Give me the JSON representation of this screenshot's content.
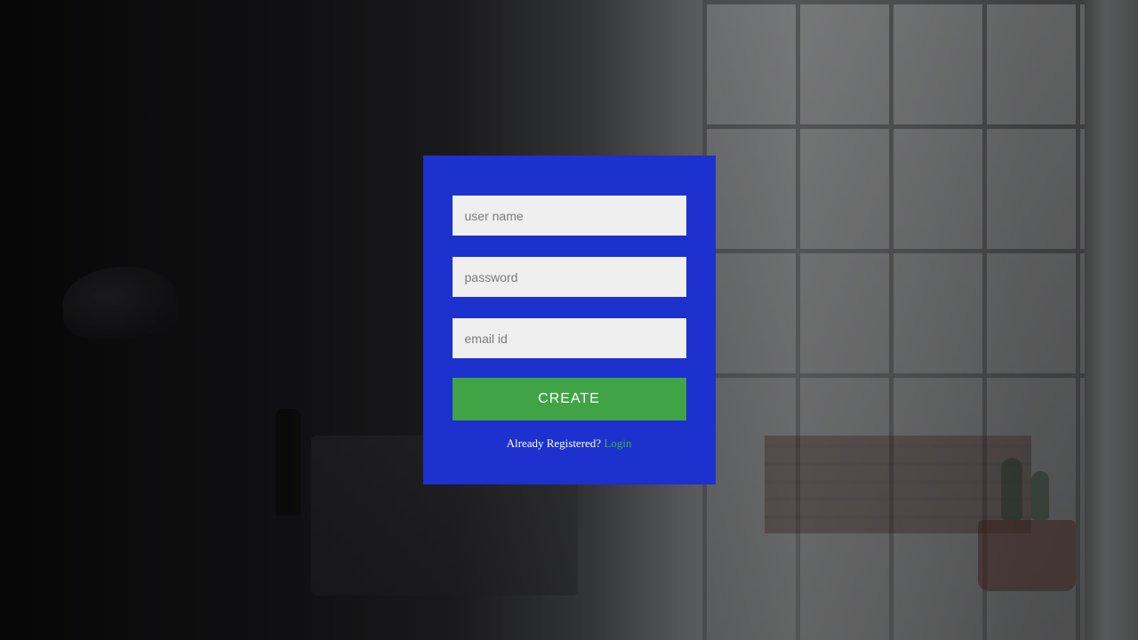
{
  "form": {
    "username_placeholder": "user name",
    "password_placeholder": "password",
    "email_placeholder": "email id",
    "create_label": "CREATE",
    "already_registered_text": "Already Registered? ",
    "login_link_text": "Login"
  }
}
